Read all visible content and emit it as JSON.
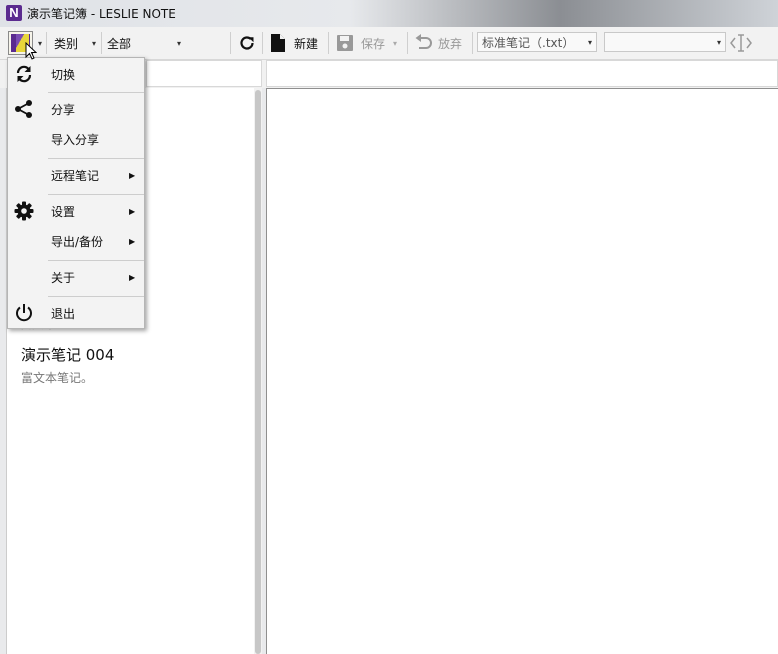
{
  "window": {
    "title": "演示笔记簿 - LESLIE NOTE",
    "app_icon": "N"
  },
  "toolbar": {
    "category_label": "类别",
    "filter_value": "全部",
    "new_label": "新建",
    "save_label": "保存",
    "discard_label": "放弃",
    "format_value": "标准笔记（.txt）",
    "font_value": ""
  },
  "notes": [
    {
      "title": "演示笔记 004",
      "subtitle": "富文本笔记。"
    }
  ],
  "menu": {
    "items": [
      {
        "label": "切换",
        "icon": "sync-icon"
      },
      {
        "label": "分享",
        "icon": "share-icon"
      },
      {
        "label": "导入分享",
        "icon": ""
      },
      {
        "label": "远程笔记",
        "icon": "",
        "submenu": true
      },
      {
        "label": "设置",
        "icon": "gear-icon",
        "submenu": true
      },
      {
        "label": "导出/备份",
        "icon": "",
        "submenu": true
      },
      {
        "label": "关于",
        "icon": "",
        "submenu": true
      },
      {
        "label": "退出",
        "icon": "power-icon"
      }
    ]
  },
  "colors": {
    "brand": "#5b2b8f",
    "accent": "#e8d63b"
  }
}
